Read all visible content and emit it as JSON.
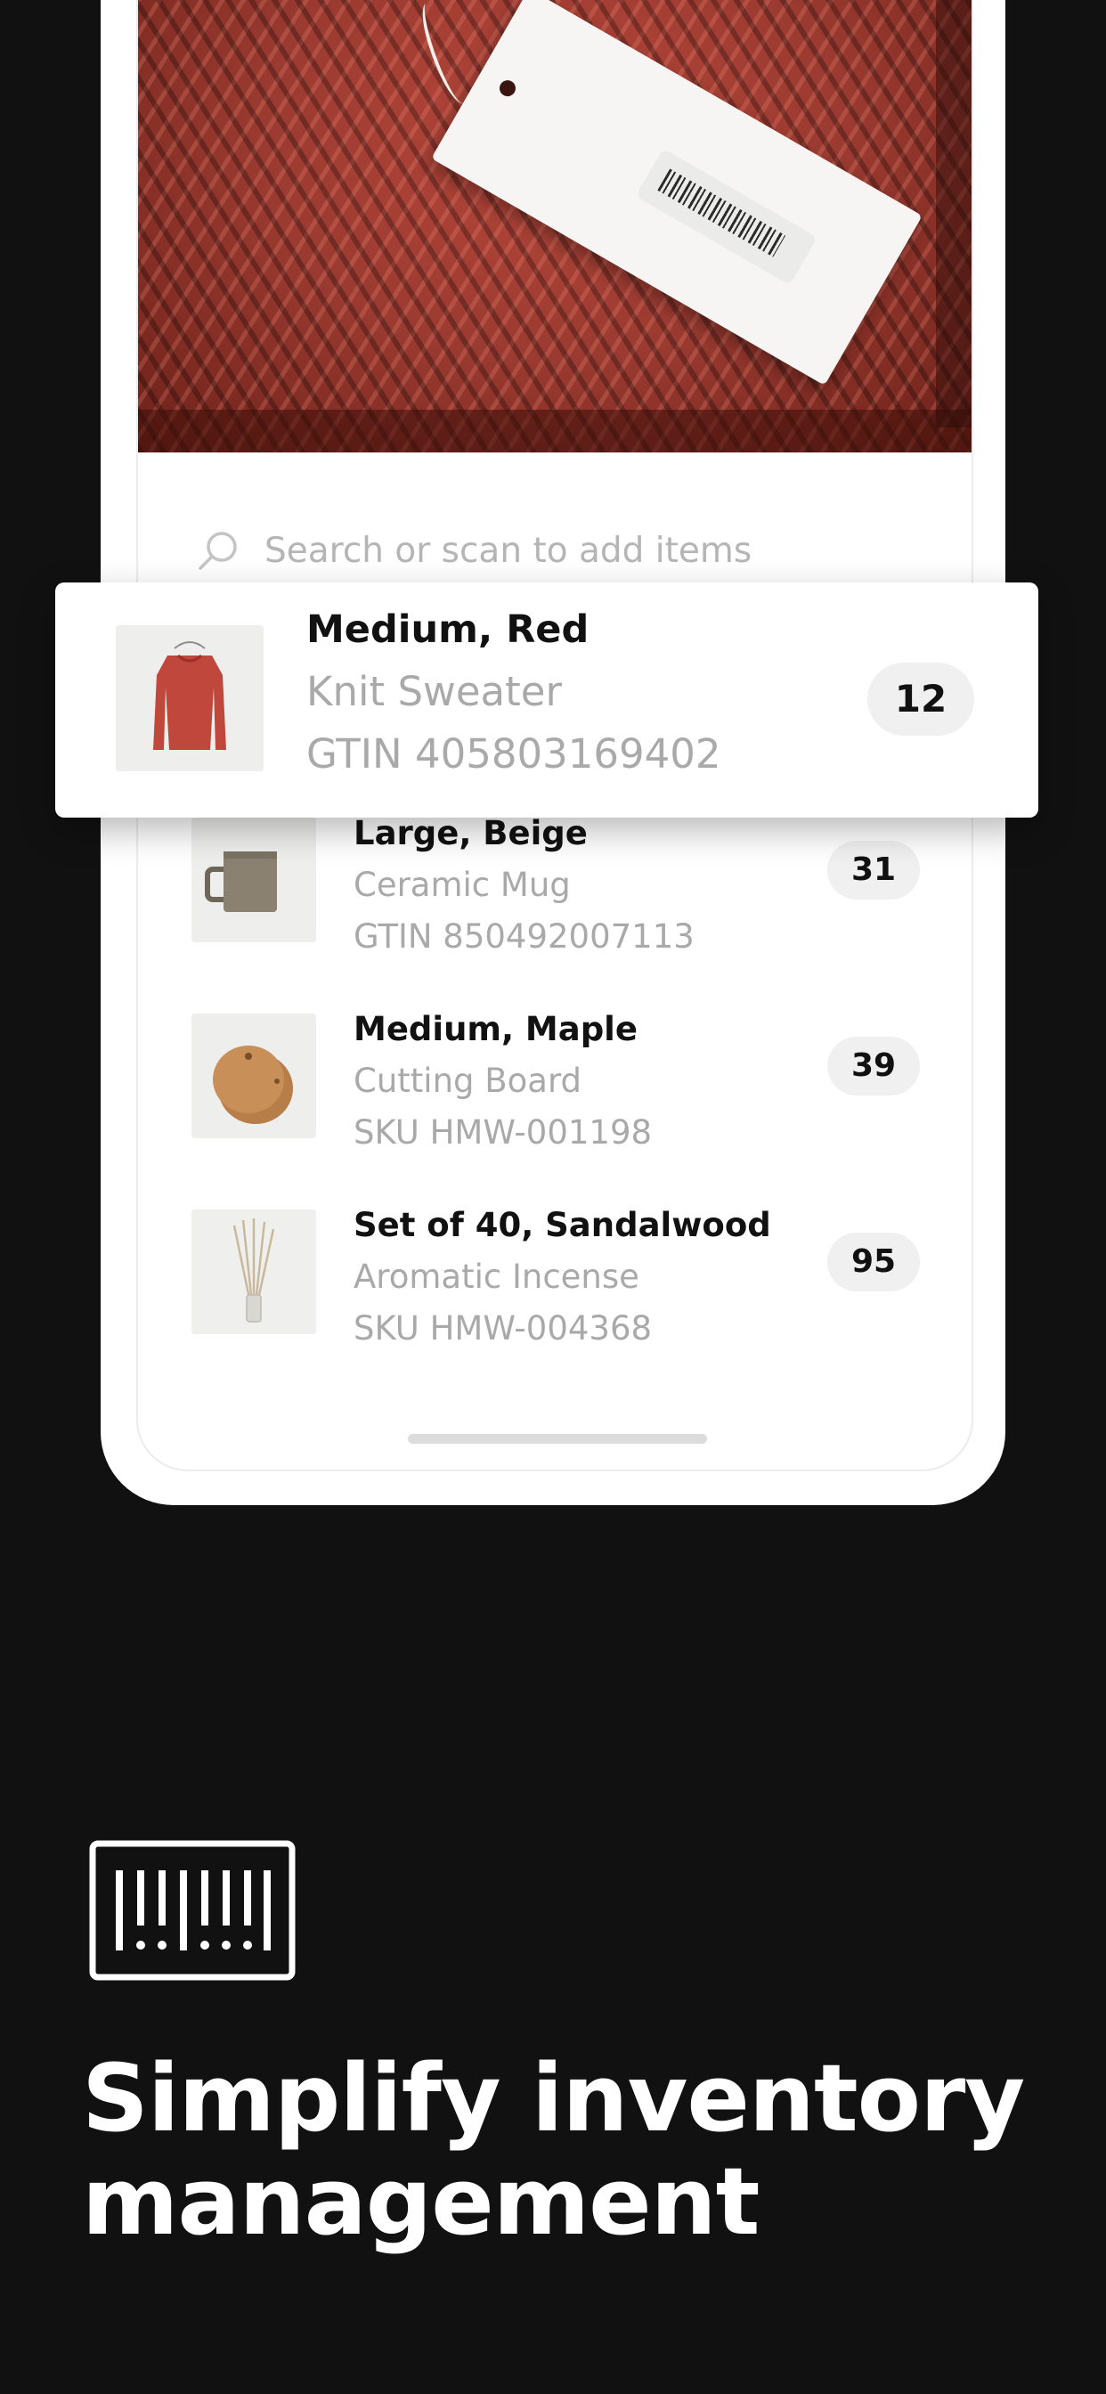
{
  "search": {
    "placeholder": "Search or scan to add items"
  },
  "highlighted_item": {
    "title": "Medium, Red",
    "name": "Knit Sweater",
    "code": "GTIN 405803169402",
    "quantity": "12",
    "thumbnail": "red-knit-sweater"
  },
  "items": [
    {
      "title": "Large, Beige",
      "name": "Ceramic Mug",
      "code": "GTIN 850492007113",
      "quantity": "31",
      "thumbnail": "ceramic-mug"
    },
    {
      "title": "Medium, Maple",
      "name": "Cutting Board",
      "code": "SKU HMW-001198",
      "quantity": "39",
      "thumbnail": "cutting-board"
    },
    {
      "title": "Set of 40, Sandalwood",
      "name": "Aromatic Incense",
      "code": "SKU HMW-004368",
      "quantity": "95",
      "thumbnail": "incense-sticks"
    }
  ],
  "marketing": {
    "icon": "barcode-icon",
    "headline": "Simplify inventory management"
  },
  "colors": {
    "background": "#111111",
    "card": "#ffffff",
    "text_primary": "#111111",
    "text_secondary": "#a9a9a9",
    "quantity_pill": "#f0f0f0",
    "headline": "#ffffff"
  }
}
